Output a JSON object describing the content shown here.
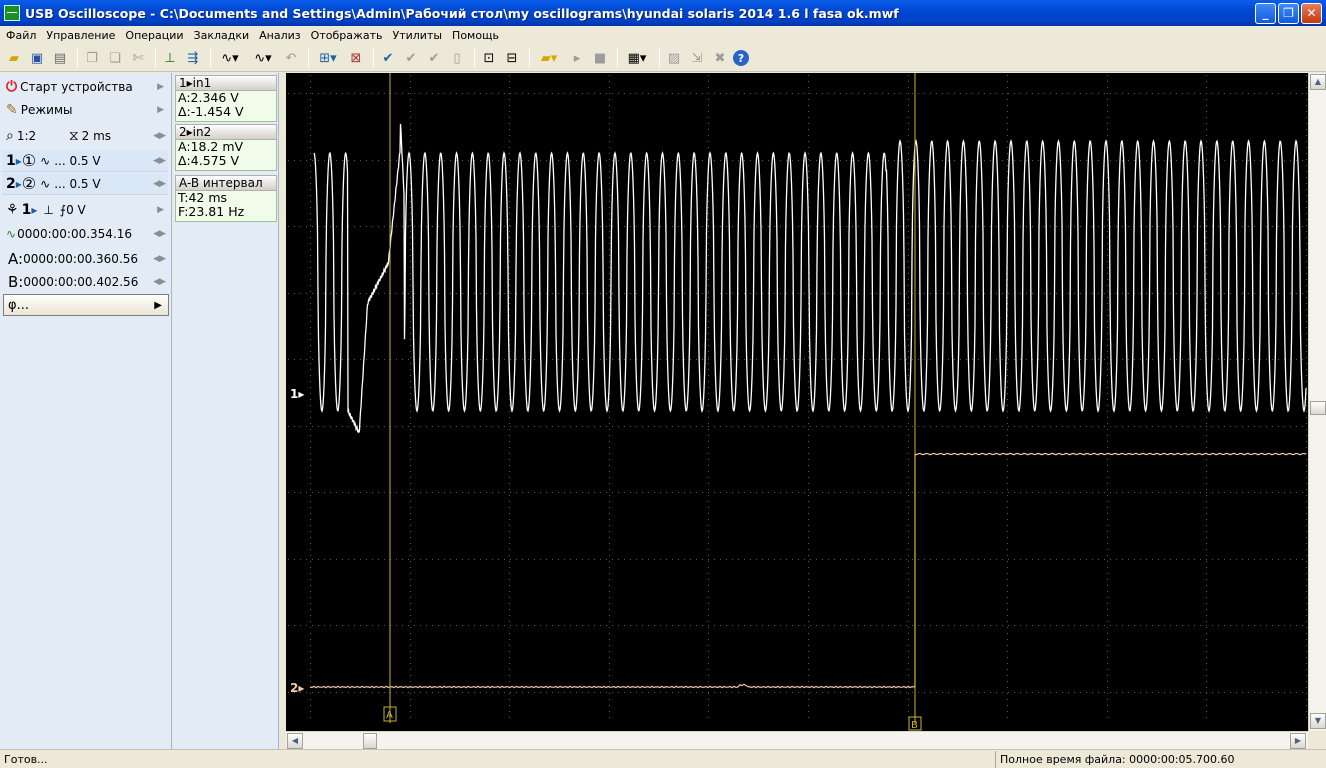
{
  "window": {
    "title": "USB Oscilloscope - C:\\Documents and Settings\\Admin\\Рабочий стол\\my oscillograms\\hyundai solaris 2014 1.6 l fasa ok.mwf",
    "minimize": "_",
    "maximize": "❐",
    "close": "✕"
  },
  "menu": [
    "Файл",
    "Управление",
    "Операции",
    "Закладки",
    "Анализ",
    "Отображать",
    "Утилиты",
    "Помощь"
  ],
  "left_panel": {
    "start_label": "Старт устройства",
    "modes_label": "Режимы",
    "zoom_value": "1:2",
    "timebase_value": "2 ms",
    "ch1_number": "1",
    "ch1_circle": "①",
    "ch1_scale": "... 0.5 V",
    "ch2_number": "2",
    "ch2_circle": "②",
    "ch2_scale": "... 0.5 V",
    "trigger_channel": "1",
    "trigger_level": "0 V",
    "time_position": "0000:00:00.354.16",
    "cursor_a_label": "A:",
    "cursor_a_time": "0000:00:00.360.56",
    "cursor_b_label": "B:",
    "cursor_b_time": "0000:00:00.402.56",
    "phi_label": "φ...",
    "arrow": "▶",
    "dual_arrow": "◀▶"
  },
  "measurements": {
    "ch1_header": "1▸in1",
    "ch1_a": "A:2.346 V",
    "ch1_delta": "Δ:-1.454 V",
    "ch2_header": "2▸in2",
    "ch2_a": "A:18.2 mV",
    "ch2_delta": "Δ:4.575 V",
    "ab_header": "A-B интервал",
    "ab_t": "T:42 ms",
    "ab_f": "F:23.81 Hz"
  },
  "scope": {
    "background": "#000000",
    "grid_color": "#5a5a5a",
    "ch1_color": "#ffffff",
    "ch2_color": "#f4c9a8",
    "cursor_color": "#c8b42a",
    "ch1_marker": "1▸",
    "ch2_marker": "2▸",
    "cursor_a": "A",
    "cursor_b": "B"
  },
  "status": {
    "left": "Готов...",
    "right": "Полное время файла: 0000:00:05.700.60"
  }
}
